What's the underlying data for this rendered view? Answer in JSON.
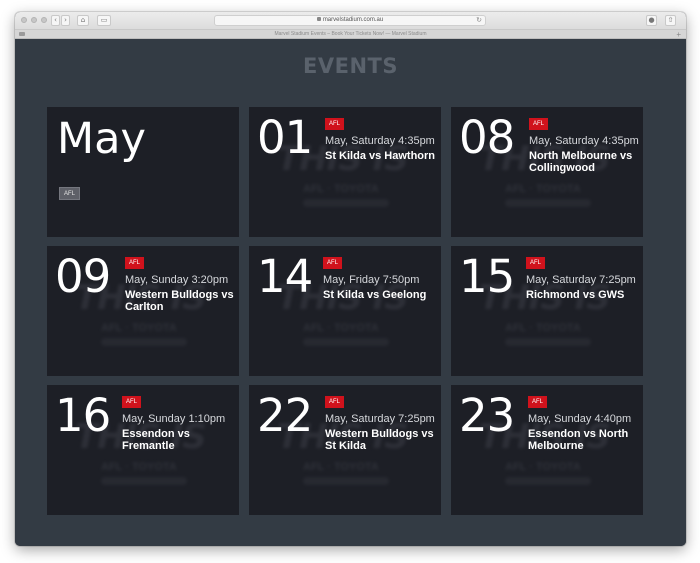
{
  "browser": {
    "url": "marvelstadium.com.au",
    "tab_title": "Marvel Stadium Events – Book Your Tickets Now! — Marvel Stadium"
  },
  "page": {
    "heading": "EVENTS"
  },
  "month_card": {
    "month": "May",
    "badge": "AFL"
  },
  "events": [
    {
      "day": "01",
      "badge": "AFL",
      "when": "May, Saturday 4:35pm",
      "match": "St Kilda vs Hawthorn"
    },
    {
      "day": "08",
      "badge": "AFL",
      "when": "May, Saturday 4:35pm",
      "match": "North Melbourne vs Collingwood"
    },
    {
      "day": "09",
      "badge": "AFL",
      "when": "May, Sunday 3:20pm",
      "match": "Western Bulldogs vs Carlton"
    },
    {
      "day": "14",
      "badge": "AFL",
      "when": "May, Friday 7:50pm",
      "match": "St Kilda vs Geelong"
    },
    {
      "day": "15",
      "badge": "AFL",
      "when": "May, Saturday 7:25pm",
      "match": "Richmond vs GWS"
    },
    {
      "day": "16",
      "badge": "AFL",
      "when": "May, Sunday 1:10pm",
      "match": "Essendon vs Fremantle"
    },
    {
      "day": "22",
      "badge": "AFL",
      "when": "May, Saturday 7:25pm",
      "match": "Western Bulldogs vs St Kilda"
    },
    {
      "day": "23",
      "badge": "AFL",
      "when": "May, Sunday 4:40pm",
      "match": "Essendon vs North Melbourne"
    }
  ],
  "ghost_art": {
    "line1": "THIS IS",
    "line2": "AFL · TOYOTA"
  },
  "colors": {
    "accent": "#d0121c",
    "page_bg": "#333b44",
    "card_bg": "#1d1f26",
    "heading": "#5a626c"
  }
}
